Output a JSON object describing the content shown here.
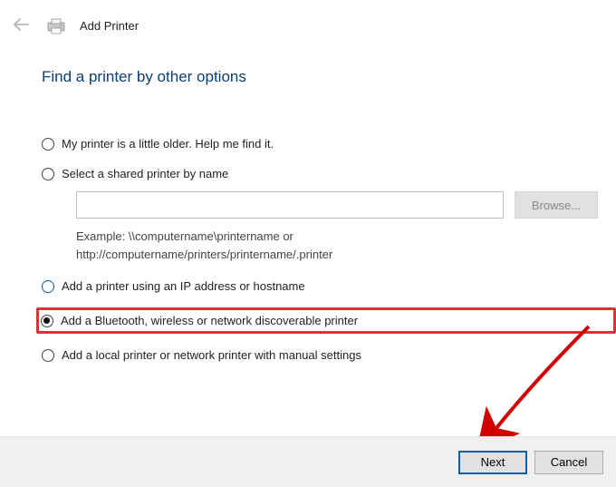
{
  "header": {
    "title": "Add Printer"
  },
  "heading": "Find a printer by other options",
  "options": {
    "older": "My printer is a little older. Help me find it.",
    "shared": "Select a shared printer by name",
    "ip": "Add a printer using an IP address or hostname",
    "bluetooth": "Add a Bluetooth, wireless or network discoverable printer",
    "local": "Add a local printer or network printer with manual settings"
  },
  "shared_input": {
    "value": "",
    "browse_label": "Browse...",
    "example_line1": "Example: \\\\computername\\printername or",
    "example_line2": "http://computername/printers/printername/.printer"
  },
  "footer": {
    "next": "Next",
    "cancel": "Cancel"
  }
}
